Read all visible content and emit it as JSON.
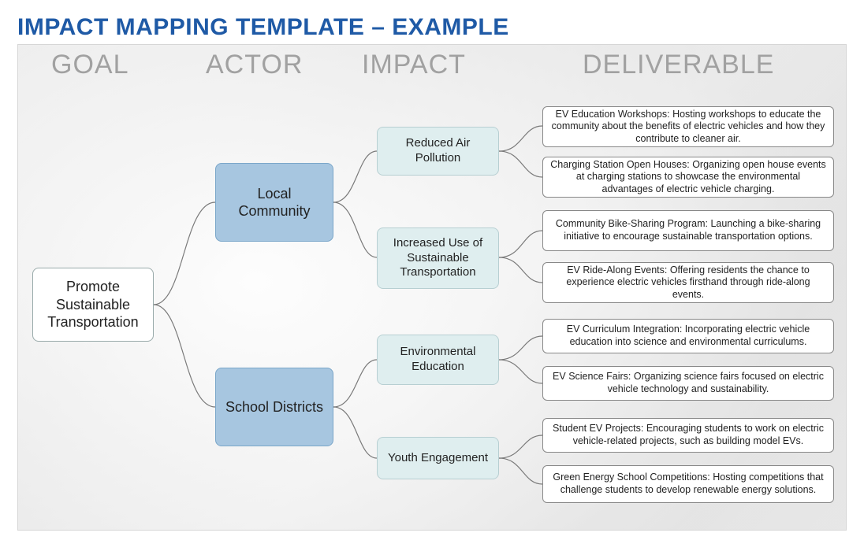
{
  "title": "IMPACT MAPPING TEMPLATE – EXAMPLE",
  "headers": {
    "goal": "GOAL",
    "actor": "ACTOR",
    "impact": "IMPACT",
    "deliverable": "DELIVERABLE"
  },
  "goal": "Promote Sustainable Transportation",
  "actors": [
    {
      "label": "Local Community"
    },
    {
      "label": "School Districts"
    }
  ],
  "impacts": [
    {
      "label": "Reduced Air Pollution"
    },
    {
      "label": "Increased Use of Sustainable Transportation"
    },
    {
      "label": "Environmental Education"
    },
    {
      "label": "Youth Engagement"
    }
  ],
  "deliverables": [
    {
      "label": "EV Education Workshops: Hosting workshops to educate the community about the benefits of electric vehicles and how they contribute to cleaner air."
    },
    {
      "label": "Charging Station Open Houses: Organizing open house events at charging stations to showcase the environmental advantages of electric vehicle charging."
    },
    {
      "label": "Community Bike-Sharing Program: Launching a bike-sharing initiative to encourage sustainable transportation options."
    },
    {
      "label": "EV Ride-Along Events: Offering residents the chance to experience electric vehicles firsthand through ride-along events."
    },
    {
      "label": "EV Curriculum Integration: Incorporating electric vehicle education into science and environmental curriculums."
    },
    {
      "label": "EV Science Fairs: Organizing science fairs focused on electric vehicle technology and sustainability."
    },
    {
      "label": "Student EV Projects: Encouraging students to work on electric vehicle-related projects, such as building model EVs."
    },
    {
      "label": "Green Energy School Competitions: Hosting competitions that challenge students to develop renewable energy solutions."
    }
  ]
}
